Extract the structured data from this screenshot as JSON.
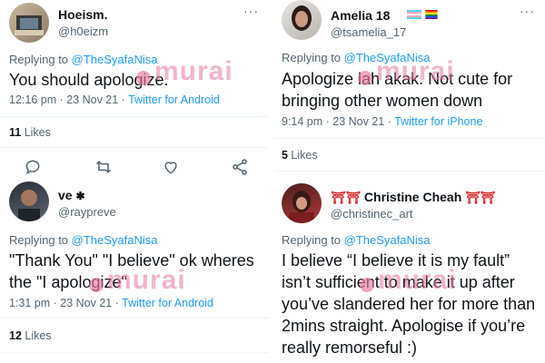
{
  "colors": {
    "link": "#1d9bf0",
    "text": "#0f1419",
    "muted": "#536471",
    "watermark": "#e878a0"
  },
  "watermark": {
    "text": "murai"
  },
  "tweets": [
    {
      "name": "Hoeism.",
      "handle": "@h0eizm",
      "replying_prefix": "Replying to ",
      "replying_to": "@TheSyafaNisa",
      "body": "You should apologize.",
      "time": "12:16 pm · 23 Nov 21 · ",
      "source": "Twitter for Android",
      "likes_count": "11",
      "likes_label": " Likes"
    },
    {
      "name": "Amelia 18",
      "handle": "@tsamelia_17",
      "replying_prefix": "Replying to ",
      "replying_to": "@TheSyafaNisa",
      "body": "Apologize lah akak. Not cute for bringing other women down",
      "time": "9:14 pm · 23 Nov 21 · ",
      "source": "Twitter for iPhone",
      "likes_count": "5",
      "likes_label": " Likes"
    },
    {
      "name": "ve",
      "handle": "@raypreve",
      "replying_prefix": "Replying to ",
      "replying_to": "@TheSyafaNisa",
      "body": "\"Thank You\" \"I believe\" ok wheres the \"I apologize\"",
      "time": "1:31 pm · 23 Nov 21 · ",
      "source": "Twitter for Android",
      "likes_count": "12",
      "likes_label": " Likes"
    },
    {
      "name": "Christine Cheah",
      "handle": "@christinec_art",
      "replying_prefix": "Replying to ",
      "replying_to": "@TheSyafaNisa",
      "body": "I believe “I believe it is my fault” isn’t sufficient to make it up after you’ve slandered her for more than 2mins straight. Apologise if you’re really remorseful :)"
    }
  ],
  "action_icons": [
    "reply-icon",
    "retweet-icon",
    "like-icon",
    "share-icon"
  ]
}
